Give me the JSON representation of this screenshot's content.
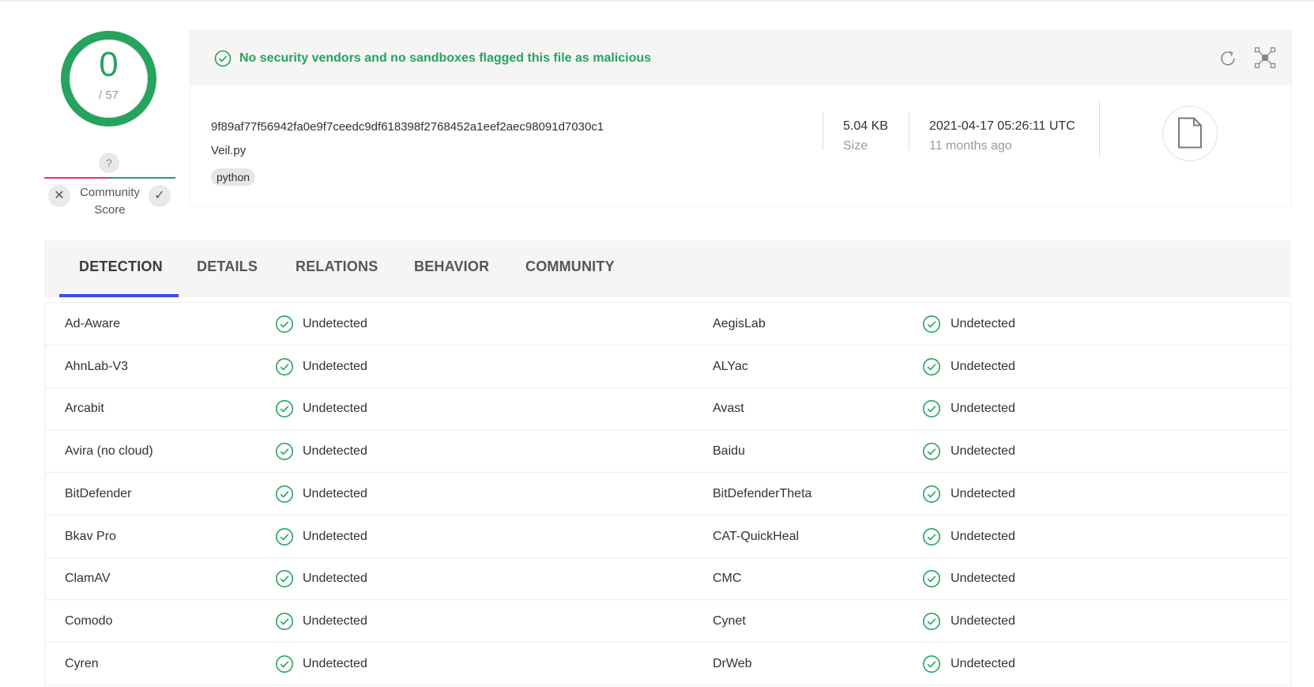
{
  "score": {
    "value": "0",
    "total": "/ 57",
    "color_ok": "#26a35e"
  },
  "community": {
    "question": "?",
    "label_line1": "Community",
    "label_line2": "Score",
    "x_icon": "close-icon",
    "check_icon": "check-icon"
  },
  "banner": {
    "text": "No security vendors and no sandboxes flagged this file as malicious",
    "color": "#26a35e"
  },
  "file": {
    "hash": "9f89af77f56942fa0e9f7ceedc9df618398f2768452a1eef2aec98091d7030c1",
    "name": "Veil.py",
    "tag": "python",
    "size_value": "5.04 KB",
    "size_label": "Size",
    "date_value": "2021-04-17 05:26:11 UTC",
    "date_label": "11 months ago"
  },
  "tabs": [
    {
      "label": "DETECTION",
      "active": true
    },
    {
      "label": "DETAILS",
      "active": false
    },
    {
      "label": "RELATIONS",
      "active": false
    },
    {
      "label": "BEHAVIOR",
      "active": false
    },
    {
      "label": "COMMUNITY",
      "active": false
    }
  ],
  "accent_color": "#3b4ee0",
  "results": [
    {
      "left_engine": "Ad-Aware",
      "left_result": "Undetected",
      "right_engine": "AegisLab",
      "right_result": "Undetected"
    },
    {
      "left_engine": "AhnLab-V3",
      "left_result": "Undetected",
      "right_engine": "ALYac",
      "right_result": "Undetected"
    },
    {
      "left_engine": "Arcabit",
      "left_result": "Undetected",
      "right_engine": "Avast",
      "right_result": "Undetected"
    },
    {
      "left_engine": "Avira (no cloud)",
      "left_result": "Undetected",
      "right_engine": "Baidu",
      "right_result": "Undetected"
    },
    {
      "left_engine": "BitDefender",
      "left_result": "Undetected",
      "right_engine": "BitDefenderTheta",
      "right_result": "Undetected"
    },
    {
      "left_engine": "Bkav Pro",
      "left_result": "Undetected",
      "right_engine": "CAT-QuickHeal",
      "right_result": "Undetected"
    },
    {
      "left_engine": "ClamAV",
      "left_result": "Undetected",
      "right_engine": "CMC",
      "right_result": "Undetected"
    },
    {
      "left_engine": "Comodo",
      "left_result": "Undetected",
      "right_engine": "Cynet",
      "right_result": "Undetected"
    },
    {
      "left_engine": "Cyren",
      "left_result": "Undetected",
      "right_engine": "DrWeb",
      "right_result": "Undetected"
    }
  ]
}
